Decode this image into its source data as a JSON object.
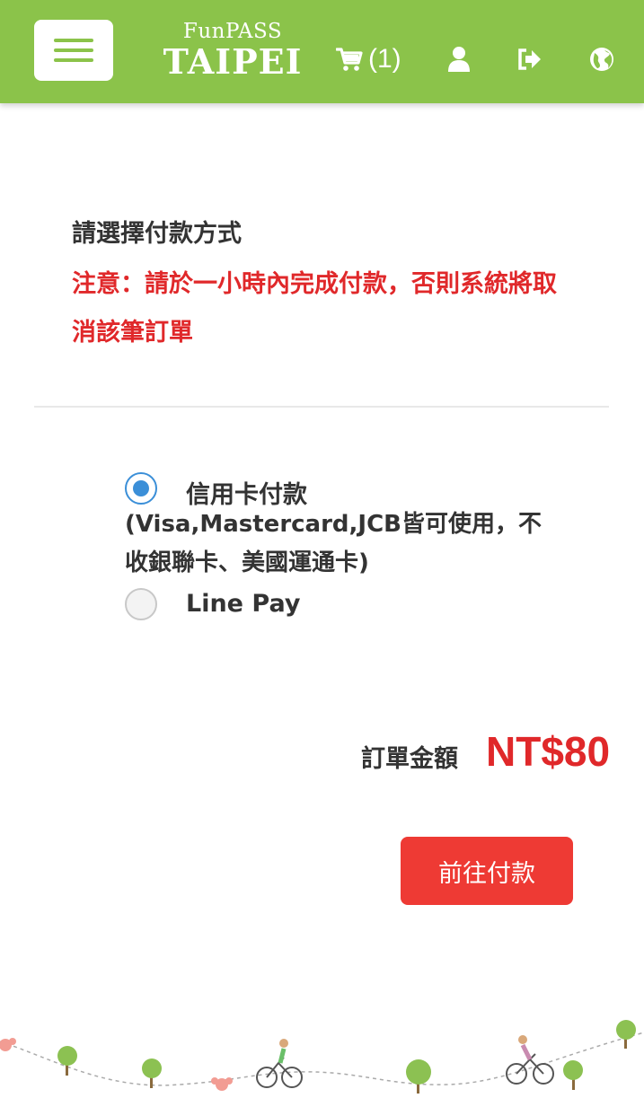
{
  "header": {
    "logo_top": "FunPASS",
    "logo_bottom": "TAIPEI",
    "cart_count": "(1)",
    "brand_color": "#8bc34a",
    "icons": [
      "menu-icon",
      "cart-icon",
      "user-icon",
      "logout-icon",
      "globe-icon"
    ]
  },
  "payment": {
    "title": "請選擇付款方式",
    "warning": "注意：請於一小時內完成付款，否則系統將取消該筆訂單",
    "options": [
      {
        "label": "信用卡付款",
        "sublabel": "(Visa,Mastercard,JCB皆可使用，不收銀聯卡、美國運通卡)",
        "selected": true
      },
      {
        "label": "Line Pay",
        "selected": false
      }
    ]
  },
  "order": {
    "total_label": "訂單金額",
    "total_amount": "NT$80"
  },
  "actions": {
    "pay_label": "前往付款",
    "pay_color": "#ee3a34"
  },
  "colors": {
    "accent_red": "#e0282a",
    "radio_blue": "#3b8fd8"
  }
}
